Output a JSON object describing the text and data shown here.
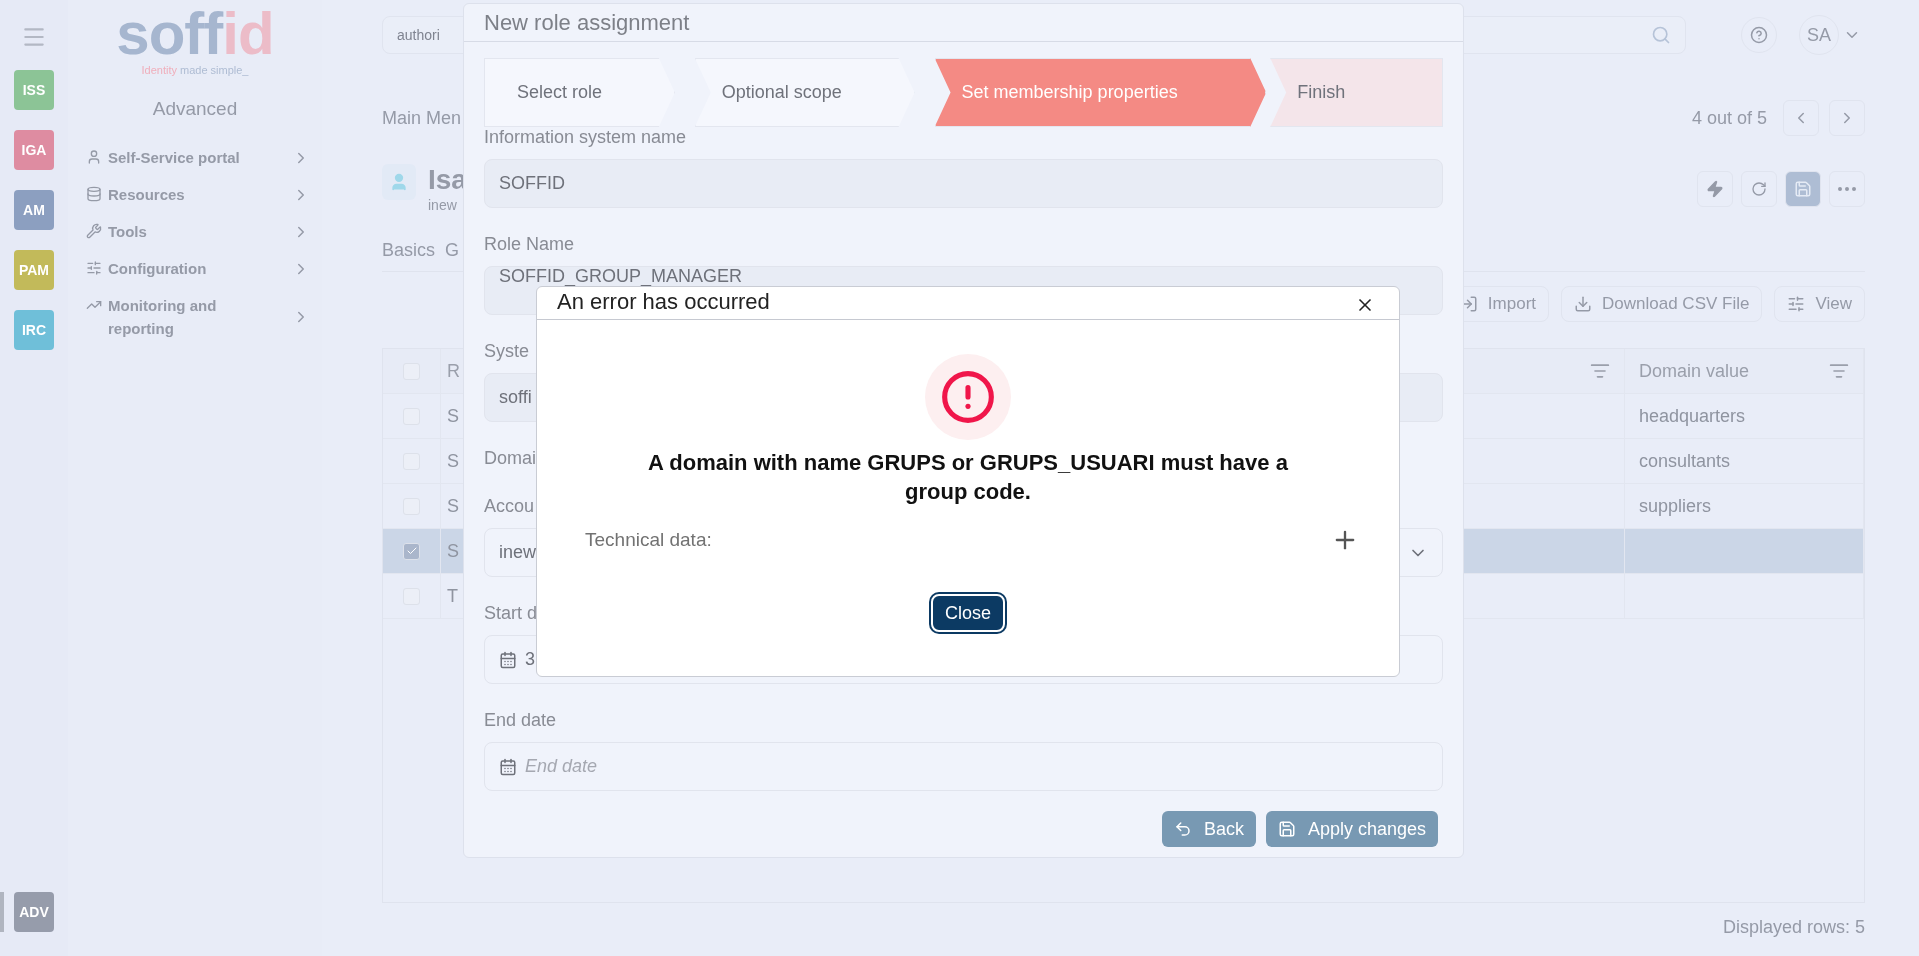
{
  "rail": {
    "items": [
      {
        "label": "ISS",
        "color": "#8cc496",
        "selected": false
      },
      {
        "label": "IGA",
        "color": "#de8ca1",
        "selected": false
      },
      {
        "label": "AM",
        "color": "#8c9fc0",
        "selected": false
      },
      {
        "label": "PAM",
        "color": "#c2ba5a",
        "selected": false
      },
      {
        "label": "IRC",
        "color": "#6fbfd9",
        "selected": false
      }
    ],
    "bottom_item": {
      "label": "ADV",
      "color": "#969cab",
      "selected": true
    }
  },
  "sidebar": {
    "logo": {
      "word_a": "soff",
      "word_b": "id",
      "tagline_a": "Identity",
      "tagline_b": "made simple_"
    },
    "heading": "Advanced",
    "items": [
      {
        "kind": "user",
        "label": "Self-Service portal"
      },
      {
        "kind": "database",
        "label": "Resources"
      },
      {
        "kind": "wrench",
        "label": "Tools"
      },
      {
        "kind": "sliders",
        "label": "Configuration"
      },
      {
        "kind": "chart",
        "label": "Monitoring and reporting"
      }
    ]
  },
  "topbar": {
    "search": {
      "value": "authori"
    },
    "avatar": "SA"
  },
  "page": {
    "breadcrumb": "Main Men",
    "counter": "4 out of 5",
    "title": "Isa",
    "subtitle": "inew",
    "tabs": [
      {
        "label": "Basics",
        "selected": false
      },
      {
        "label": "G",
        "selected": false
      }
    ],
    "toolbar": [
      "Import",
      "Download CSV File",
      "View"
    ],
    "table": {
      "header_checked": false,
      "columns": [
        "R",
        "Domain value"
      ],
      "rows": [
        {
          "selected": false,
          "cells": [
            "S",
            "headquarters"
          ]
        },
        {
          "selected": false,
          "cells": [
            "S",
            "consultants"
          ]
        },
        {
          "selected": false,
          "cells": [
            "S",
            "suppliers"
          ]
        },
        {
          "selected": true,
          "cells": [
            "S",
            ""
          ]
        },
        {
          "selected": false,
          "cells": [
            "T",
            ""
          ]
        }
      ]
    },
    "footer": "Displayed rows: 5"
  },
  "modal": {
    "title": "New role assignment",
    "steps": [
      {
        "label": "Select role",
        "completed": true,
        "selected": false
      },
      {
        "label": "Optional scope",
        "completed": true,
        "selected": false
      },
      {
        "label": "Set membership properties",
        "completed": false,
        "selected": true
      },
      {
        "label": "Finish",
        "completed": false,
        "selected": false
      }
    ],
    "fields": [
      {
        "kind": "text",
        "label": "Information system name",
        "value": "SOFFID"
      },
      {
        "kind": "text",
        "label": "Role Name",
        "value": "SOFFID_GROUP_MANAGER"
      },
      {
        "kind": "text",
        "label": "Syste",
        "value": "soffi"
      },
      {
        "kind": "label",
        "label": "Domai"
      },
      {
        "kind": "select",
        "label": "Accou",
        "value": "inew"
      },
      {
        "kind": "date",
        "label": "Start d",
        "value": "3"
      },
      {
        "kind": "date",
        "label": "End date",
        "placeholder": "End date"
      }
    ],
    "buttons": [
      "Back",
      "Apply changes"
    ]
  },
  "error": {
    "title": "An error has occurred",
    "message": "A domain with name GRUPS or GRUPS_USUARI must have a group code.",
    "technical_label": "Technical data:",
    "expanded": false,
    "button": "Close"
  }
}
